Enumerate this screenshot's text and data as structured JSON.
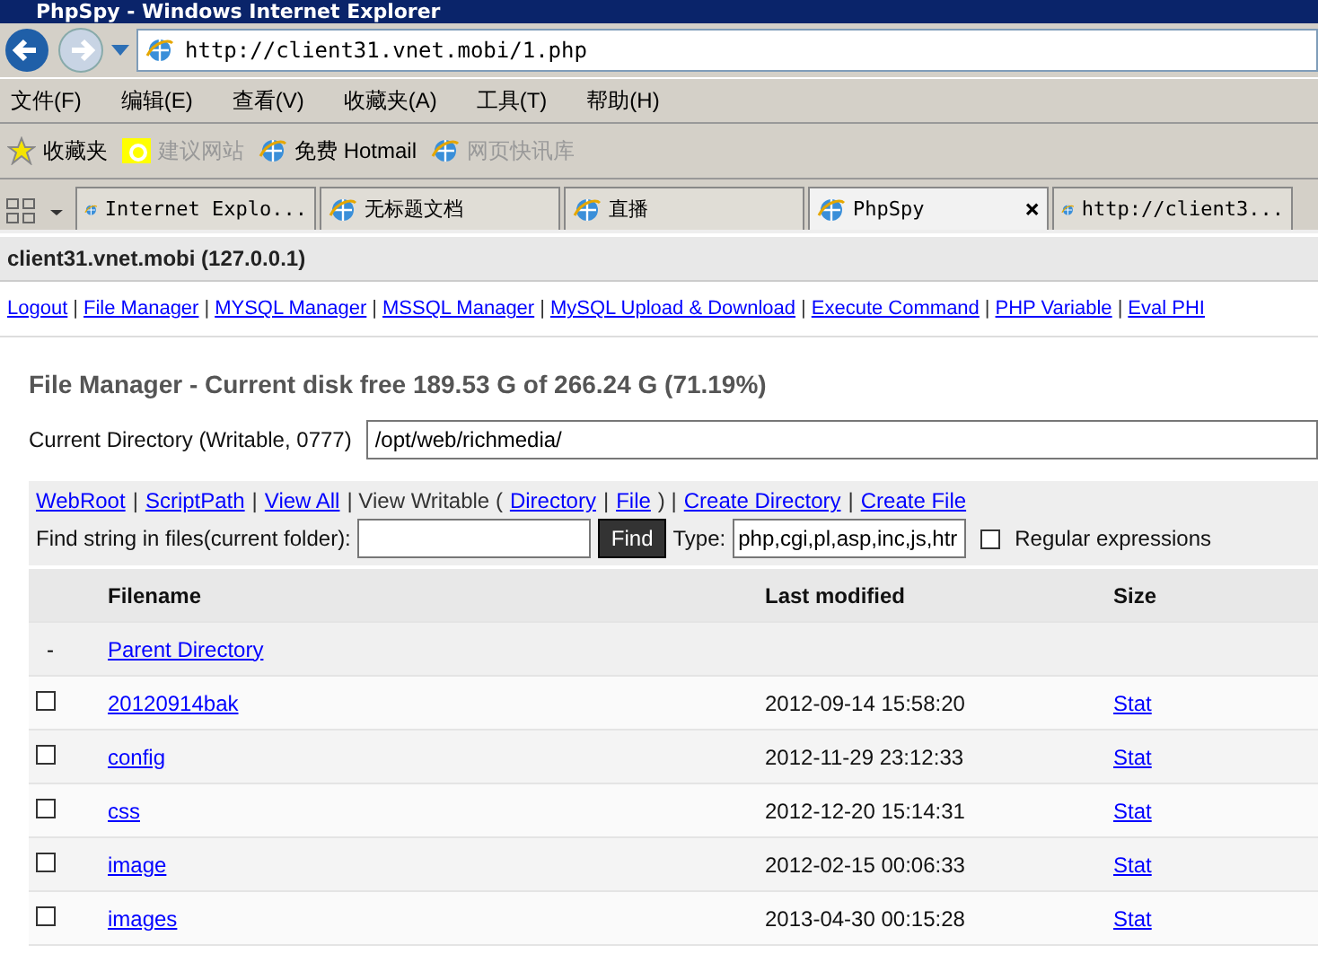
{
  "window": {
    "title": "PhpSpy - Windows Internet Explorer"
  },
  "address": {
    "url": "http://client31.vnet.mobi/1.php"
  },
  "menu": [
    "文件(F)",
    "编辑(E)",
    "查看(V)",
    "收藏夹(A)",
    "工具(T)",
    "帮助(H)"
  ],
  "favorites_bar": [
    {
      "label": "收藏夹",
      "kind": "star"
    },
    {
      "label": "建议网站",
      "kind": "suggest",
      "disabled": true
    },
    {
      "label": "免费 Hotmail",
      "kind": "page",
      "disabled": false
    },
    {
      "label": "网页快讯库",
      "kind": "feed",
      "disabled": true
    }
  ],
  "tabs": [
    {
      "label": "Internet Explo...",
      "selected": false
    },
    {
      "label": "无标题文档",
      "selected": false
    },
    {
      "label": "直播",
      "selected": false
    },
    {
      "label": "PhpSpy",
      "selected": true,
      "close": "×"
    },
    {
      "label": "http://client3...",
      "selected": false
    }
  ],
  "page": {
    "host": "client31.vnet.mobi (127.0.0.1)",
    "nav_links": [
      {
        "kind": "link",
        "text": "Logout"
      },
      {
        "kind": "sep",
        "text": "|"
      },
      {
        "kind": "link",
        "text": "File Manager"
      },
      {
        "kind": "sep",
        "text": "|"
      },
      {
        "kind": "link",
        "text": "MYSQL Manager"
      },
      {
        "kind": "sep",
        "text": "|"
      },
      {
        "kind": "link",
        "text": "MSSQL Manager"
      },
      {
        "kind": "sep",
        "text": "|"
      },
      {
        "kind": "link",
        "text": "MySQL Upload & Download"
      },
      {
        "kind": "sep",
        "text": "|"
      },
      {
        "kind": "link",
        "text": "Execute Command"
      },
      {
        "kind": "sep",
        "text": "|"
      },
      {
        "kind": "link",
        "text": "PHP Variable"
      },
      {
        "kind": "sep",
        "text": "|"
      },
      {
        "kind": "link",
        "text": "Eval PHI"
      }
    ],
    "heading": "File Manager - Current disk free 189.53 G of 266.24 G (71.19%)",
    "current_directory": {
      "label": "Current Directory (Writable, 0777)",
      "value": "/opt/web/richmedia/"
    },
    "tools": [
      {
        "kind": "link",
        "text": "WebRoot"
      },
      {
        "kind": "sep",
        "text": "|"
      },
      {
        "kind": "link",
        "text": "ScriptPath"
      },
      {
        "kind": "sep",
        "text": "|"
      },
      {
        "kind": "link",
        "text": "View All"
      },
      {
        "kind": "sep",
        "text": "| View Writable ("
      },
      {
        "kind": "link",
        "text": "Directory"
      },
      {
        "kind": "sep",
        "text": "|"
      },
      {
        "kind": "link",
        "text": "File"
      },
      {
        "kind": "sep",
        "text": ") |"
      },
      {
        "kind": "link",
        "text": "Create Directory"
      },
      {
        "kind": "sep",
        "text": "|"
      },
      {
        "kind": "link",
        "text": "Create File"
      }
    ],
    "find": {
      "label": "Find string in files(current folder):",
      "button": "Find",
      "type_label": "Type:",
      "type_value": "php,cgi,pl,asp,inc,js,htr",
      "regex_label": "Regular expressions",
      "regex_checked": false
    },
    "table": {
      "columns": [
        "Filename",
        "Last modified",
        "Size"
      ],
      "parent": {
        "marker": "-",
        "name": "Parent Directory"
      },
      "rows": [
        {
          "name": "20120914bak",
          "modified": "2012-09-14 15:58:20",
          "size": "Stat",
          "checked": false
        },
        {
          "name": "config",
          "modified": "2012-11-29 23:12:33",
          "size": "Stat",
          "checked": false
        },
        {
          "name": "css",
          "modified": "2012-12-20 15:14:31",
          "size": "Stat",
          "checked": false
        },
        {
          "name": "image",
          "modified": "2012-02-15 00:06:33",
          "size": "Stat",
          "checked": false
        },
        {
          "name": "images",
          "modified": "2013-04-30 00:15:28",
          "size": "Stat",
          "checked": false
        }
      ]
    }
  }
}
